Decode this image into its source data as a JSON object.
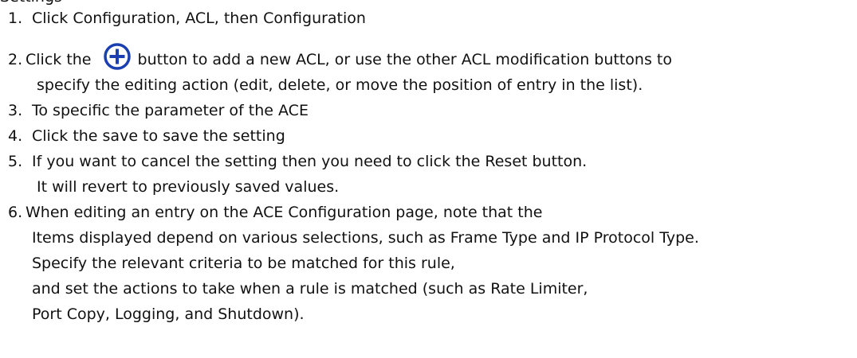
{
  "document": {
    "heading_fragment": "Settings",
    "steps": {
      "s1": {
        "number": "1.",
        "text": "Click Configuration, ACL, then Configuration"
      },
      "s2": {
        "number": "2.",
        "before": "Click the",
        "icon": "plus-circle-icon",
        "after": "button to add a new ACL, or use the other ACL modification buttons to",
        "cont1": "specify the editing action (edit, delete, or move the position of entry in the list)."
      },
      "s3": {
        "number": "3.",
        "text": "To specific the parameter of the ACE"
      },
      "s4": {
        "number": "4.",
        "text": "Click the save to save the setting"
      },
      "s5": {
        "number": "5.",
        "text": "If you want to cancel the setting then you need to click the Reset button.",
        "cont1": "It will revert to previously saved values."
      },
      "s6": {
        "number": "6.",
        "text": "When editing an entry on the ACE Configuration page, note that the",
        "cont1": "Items displayed depend on various selections, such as Frame Type and IP Protocol Type.",
        "cont2": "Specify the relevant criteria to be matched for this rule,",
        "cont3": "and set the actions to take when a rule is matched (such as Rate Limiter,",
        "cont4": "Port Copy, Logging, and Shutdown)."
      }
    },
    "icon_color": "#1a3fb0"
  }
}
